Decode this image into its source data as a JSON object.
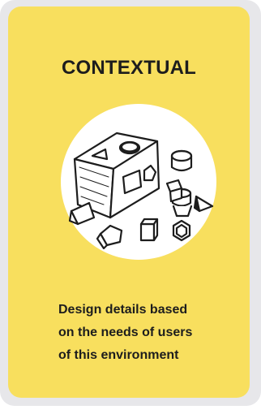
{
  "card": {
    "title": "CONTEXTUAL",
    "description_lines": [
      "Design details based",
      "on the needs of users",
      "of this environment"
    ],
    "illustration": "shape-sorter-icon",
    "colors": {
      "card_background": "#f8df5e",
      "outer_frame": "#e7e7ea",
      "circle": "#ffffff",
      "ink": "#1d1d1d"
    }
  }
}
